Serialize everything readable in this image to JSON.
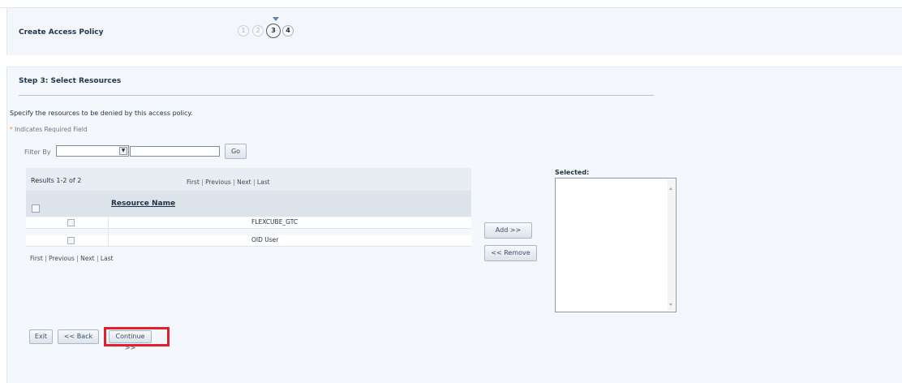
{
  "header": {
    "title": "Create Access Policy",
    "train": {
      "steps": [
        "1",
        "2",
        "3",
        "4"
      ],
      "current_step": "3"
    }
  },
  "step": {
    "title": "Step 3: Select Resources",
    "instruction": "Specify the resources to be denied by this access policy.",
    "required_star": "*",
    "required_note": " Indicates Required Field"
  },
  "filter": {
    "label": "Filter By",
    "select_value": "",
    "text_value": "",
    "go_label": "Go"
  },
  "results": {
    "count_label": "Results 1-2 of 2",
    "nav": [
      "First",
      "Previous",
      "Next",
      "Last"
    ],
    "column_header": "Resource Name",
    "rows": [
      {
        "name": "FLEXCUBE_GTC"
      },
      {
        "name": "OID User"
      }
    ]
  },
  "shuttle": {
    "add_label": "Add >>",
    "remove_label": "<< Remove",
    "selected_label": "Selected:"
  },
  "footer": {
    "exit_label": "Exit",
    "back_label": "<< Back",
    "continue_label": "Continue >>"
  },
  "colors": {
    "highlight": "#e0202a",
    "panel_bg": "#f4f7fb",
    "table_header_bg": "#dde3ea"
  }
}
